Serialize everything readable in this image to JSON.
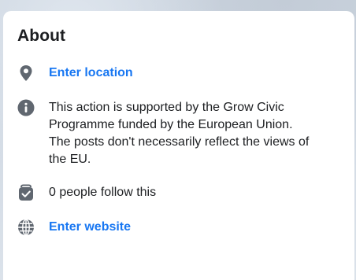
{
  "about": {
    "title": "About",
    "location_link": "Enter location",
    "description": "This action is supported by the Grow Civic Programme funded by the European Union. The posts don't necessarily reflect the views of the EU.",
    "followers": "0 people follow this",
    "website_link": "Enter website"
  },
  "icons": {
    "location": "location-pin-icon",
    "info": "info-icon",
    "followers": "follow-check-icon",
    "website": "globe-icon"
  },
  "colors": {
    "link": "#1877f2",
    "icon": "#606770",
    "text": "#1c1e21",
    "card": "#ffffff"
  }
}
